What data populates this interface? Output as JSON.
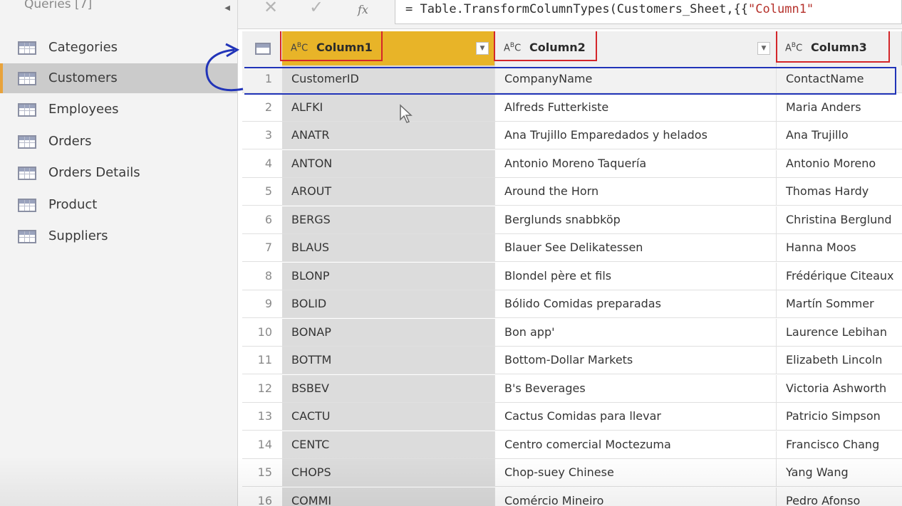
{
  "queries": {
    "header": "Queries [7]",
    "items": [
      {
        "label": "Categories"
      },
      {
        "label": "Customers"
      },
      {
        "label": "Employees"
      },
      {
        "label": "Orders"
      },
      {
        "label": "Orders Details"
      },
      {
        "label": "Product"
      },
      {
        "label": "Suppliers"
      }
    ]
  },
  "formula_bar": {
    "cancel_symbol": "✕",
    "commit_symbol": "✓",
    "fx": "fx",
    "formula_prefix": "= Table.TransformColumnTypes(Customers_Sheet,{{",
    "formula_string": "\"Column1\""
  },
  "grid": {
    "type_badge": "ABC",
    "columns": [
      "Column1",
      "Column2",
      "Column3"
    ],
    "rows": [
      {
        "n": "1",
        "c1": "CustomerID",
        "c2": "CompanyName",
        "c3": "ContactName"
      },
      {
        "n": "2",
        "c1": "ALFKI",
        "c2": "Alfreds Futterkiste",
        "c3": "Maria Anders"
      },
      {
        "n": "3",
        "c1": "ANATR",
        "c2": "Ana Trujillo Emparedados y helados",
        "c3": "Ana Trujillo"
      },
      {
        "n": "4",
        "c1": "ANTON",
        "c2": "Antonio Moreno Taquería",
        "c3": "Antonio Moreno"
      },
      {
        "n": "5",
        "c1": "AROUT",
        "c2": "Around the Horn",
        "c3": "Thomas Hardy"
      },
      {
        "n": "6",
        "c1": "BERGS",
        "c2": "Berglunds snabbköp",
        "c3": "Christina Berglund"
      },
      {
        "n": "7",
        "c1": "BLAUS",
        "c2": "Blauer See Delikatessen",
        "c3": "Hanna Moos"
      },
      {
        "n": "8",
        "c1": "BLONP",
        "c2": "Blondel père et fils",
        "c3": "Frédérique Citeaux"
      },
      {
        "n": "9",
        "c1": "BOLID",
        "c2": "Bólido Comidas preparadas",
        "c3": "Martín Sommer"
      },
      {
        "n": "10",
        "c1": "BONAP",
        "c2": "Bon app'",
        "c3": "Laurence Lebihan"
      },
      {
        "n": "11",
        "c1": "BOTTM",
        "c2": "Bottom-Dollar Markets",
        "c3": "Elizabeth Lincoln"
      },
      {
        "n": "12",
        "c1": "BSBEV",
        "c2": "B's Beverages",
        "c3": "Victoria Ashworth"
      },
      {
        "n": "13",
        "c1": "CACTU",
        "c2": "Cactus Comidas para llevar",
        "c3": "Patricio Simpson"
      },
      {
        "n": "14",
        "c1": "CENTC",
        "c2": "Centro comercial Moctezuma",
        "c3": "Francisco Chang"
      },
      {
        "n": "15",
        "c1": "CHOPS",
        "c2": "Chop-suey Chinese",
        "c3": "Yang Wang"
      },
      {
        "n": "16",
        "c1": "COMMI",
        "c2": "Comércio Mineiro",
        "c3": "Pedro Afonso"
      }
    ]
  },
  "colors": {
    "selected_column": "#e8b428",
    "annotation_red": "#d4262a",
    "annotation_blue": "#2134b8",
    "selected_query_accent": "#e8a33c"
  }
}
